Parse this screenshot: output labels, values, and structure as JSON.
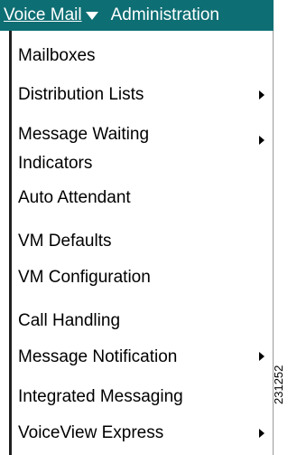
{
  "menubar": {
    "voice_mail_label": "Voice Mail",
    "administration_label": "Administration"
  },
  "dropdown": {
    "items": [
      {
        "label": "Mailboxes",
        "has_submenu": false
      },
      {
        "label": "Distribution Lists",
        "has_submenu": true
      },
      {
        "label": "Message Waiting\nIndicators",
        "has_submenu": true
      },
      {
        "label": "Auto Attendant",
        "has_submenu": false
      },
      {
        "label": "VM Defaults",
        "has_submenu": false
      },
      {
        "label": "VM Configuration",
        "has_submenu": false
      },
      {
        "label": "Call Handling",
        "has_submenu": false
      },
      {
        "label": "Message Notification",
        "has_submenu": true
      },
      {
        "label": "Integrated Messaging",
        "has_submenu": false
      },
      {
        "label": "VoiceView Express",
        "has_submenu": true
      }
    ]
  },
  "figure_id": "231252",
  "colors": {
    "menubar_background": "#0d6e73",
    "menubar_text": "#ffffff",
    "menu_text": "#000000"
  },
  "icons": {
    "menu_dropdown": "chevron-down-icon",
    "submenu": "chevron-right-icon"
  }
}
